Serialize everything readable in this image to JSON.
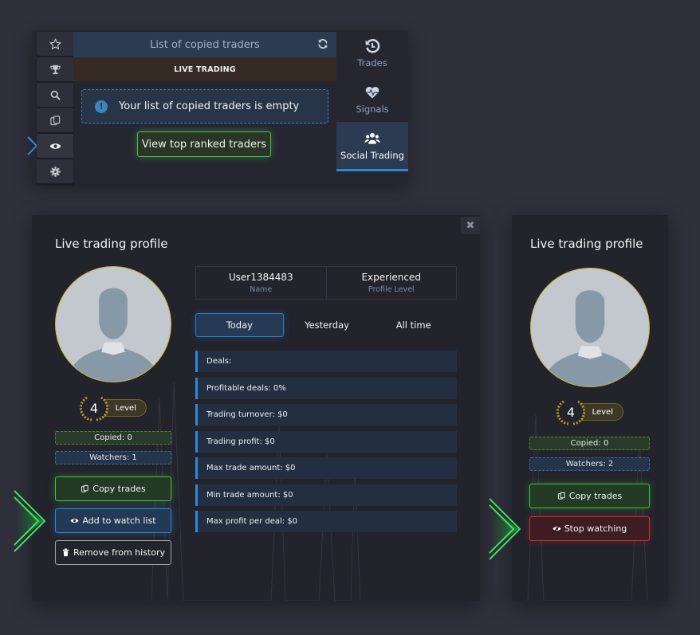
{
  "top_widget": {
    "side_icons": [
      {
        "icon": "star-icon",
        "active": false
      },
      {
        "icon": "trophy-icon",
        "active": false
      },
      {
        "icon": "search-icon",
        "active": false
      },
      {
        "icon": "copy-icon",
        "active": false
      },
      {
        "icon": "eye-icon",
        "active": true
      },
      {
        "icon": "gear-icon",
        "active": false
      }
    ],
    "header_title": "List of copied traders",
    "section_label": "LIVE TRADING",
    "empty_message": "Your list of copied traders is empty",
    "empty_icon": "!",
    "view_top_button": "View top ranked traders",
    "nav": [
      {
        "label": "Trades",
        "icon": "history-icon",
        "active": false
      },
      {
        "label": "Signals",
        "icon": "heart-pulse-icon",
        "active": false
      },
      {
        "label": "Social Trading",
        "icon": "users-icon",
        "active": true
      }
    ]
  },
  "profile_main": {
    "title": "Live trading profile",
    "close_label": "✖",
    "level_number": "4",
    "level_label": "Level",
    "copied": "Copied: 0",
    "watchers": "Watchers: 1",
    "buttons": {
      "copy": "Copy trades",
      "watch": "Add to watch list",
      "remove": "Remove from history"
    },
    "info": [
      {
        "value": "User1384483",
        "label": "Name"
      },
      {
        "value": "Experienced",
        "label": "Profile Level"
      }
    ],
    "tabs": [
      {
        "label": "Today",
        "active": true
      },
      {
        "label": "Yesterday",
        "active": false
      },
      {
        "label": "All time",
        "active": false
      }
    ],
    "stats": [
      "Deals:",
      "Profitable deals: 0%",
      "Trading turnover: $0",
      "Trading profit: $0",
      "Max trade amount: $0",
      "Min trade amount: $0",
      "Max profit per deal: $0"
    ]
  },
  "profile_side": {
    "title": "Live trading profile",
    "level_number": "4",
    "level_label": "Level",
    "copied": "Copied: 0",
    "watchers": "Watchers: 2",
    "buttons": {
      "copy": "Copy trades",
      "stop": "Stop watching"
    }
  },
  "colors": {
    "accent_blue": "#2b8ad8",
    "accent_green": "#46c046",
    "accent_red": "#c83434",
    "gold": "#c8b43a"
  }
}
